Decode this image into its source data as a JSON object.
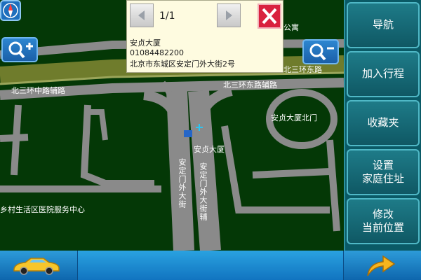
{
  "popup": {
    "page_counter": "1/1",
    "poi_name": "安贞大厦",
    "poi_phone": "01084482200",
    "poi_address": "北京市东城区安定门外大街2号"
  },
  "map_labels": {
    "ring_road_north": "北三环中路辅路",
    "ring_road_mid": "北三环东路辅路",
    "ring_road_right": "北三环东路",
    "top_right_fragment": "公寓",
    "road_vertical_1": "安定门外大街",
    "road_vertical_2": "安定门外大街辅",
    "poi_anzhen": "安贞大厦",
    "poi_anzhen_north_gate": "安贞大厦北门",
    "poi_community": "乡村生活区医院服务中心"
  },
  "sidebar": {
    "nav": "导航",
    "add_route": "加入行程",
    "favorites": "收藏夹",
    "set_home_line1": "设置",
    "set_home_line2": "家庭住址",
    "modify_line1": "修改",
    "modify_line2": "当前位置"
  },
  "icons": {
    "compass": "compass-icon",
    "zoom_in": "zoom-in-icon",
    "zoom_out": "zoom-out-icon",
    "prev": "chevron-left-icon",
    "next": "chevron-right-icon",
    "close": "close-icon",
    "car": "car-icon",
    "arrow": "turn-arrow-icon"
  },
  "colors": {
    "map_background": "#043806",
    "road_grey": "#8a8a8a",
    "highway_olive": "#6f7c2c",
    "sidebar": "#0a5a66",
    "close_red": "#d9213e"
  }
}
